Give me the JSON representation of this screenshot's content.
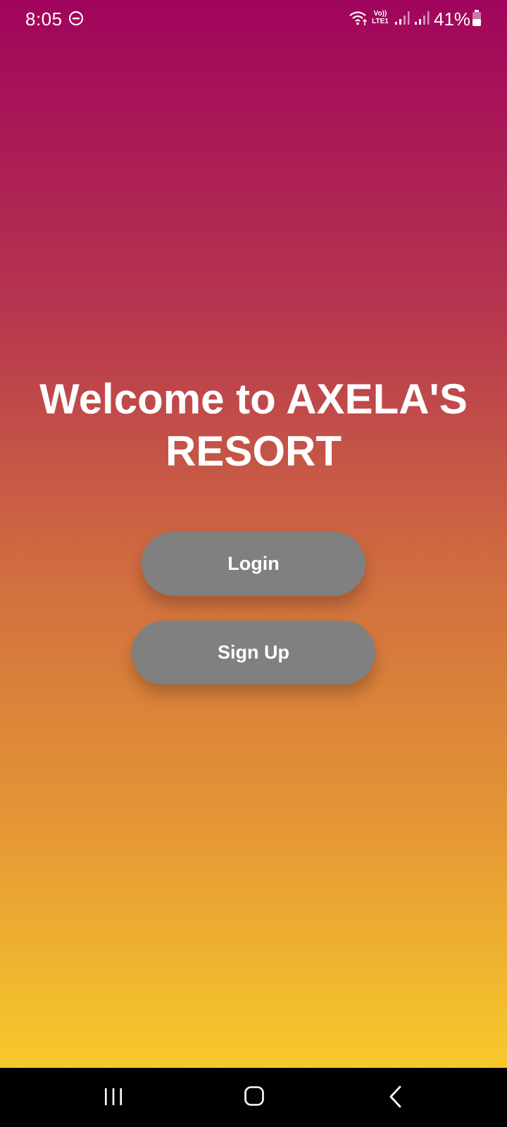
{
  "status_bar": {
    "time": "8:05",
    "volte_line1": "Vo))",
    "volte_line2": "LTE1",
    "battery_percent": "41%",
    "battery_level": 0.41,
    "icons": [
      "do-not-disturb-icon",
      "wifi-icon",
      "volte-icon",
      "signal-icon",
      "signal-icon",
      "battery-icon"
    ]
  },
  "welcome": {
    "title": "Welcome to AXELA'S RESORT"
  },
  "buttons": {
    "login_label": "Login",
    "signup_label": "Sign Up"
  },
  "nav_bar": {
    "icons": [
      "recents-icon",
      "home-icon",
      "back-icon"
    ]
  },
  "colors": {
    "gradient_top": "#a0045c",
    "gradient_bottom": "#f7c92b",
    "button_bg": "#808080",
    "text": "#ffffff",
    "nav_bg": "#000000"
  }
}
